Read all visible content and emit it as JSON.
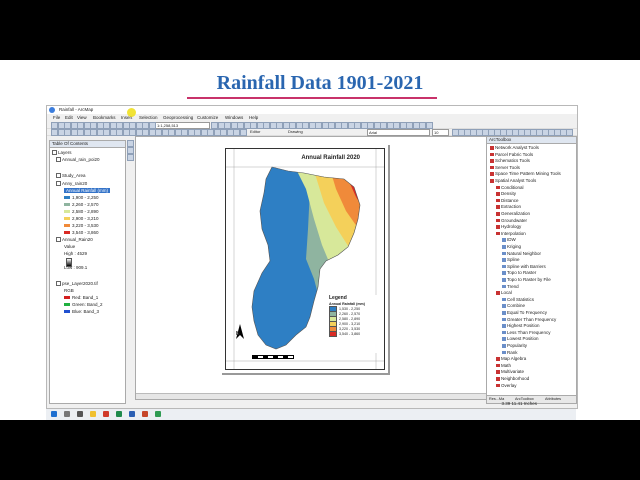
{
  "slide_title": "Rainfall Data 1901-2021",
  "window": {
    "title": "Rainfall - ArcMap"
  },
  "menu": [
    "File",
    "Edit",
    "View",
    "Bookmarks",
    "Insert",
    "Selection",
    "Geoprocessing",
    "Customize",
    "Windows",
    "Help"
  ],
  "toolbar": {
    "scale": "1:1,258,513",
    "drawing_label": "Drawing",
    "font": "Arial",
    "font_size": "10",
    "editor_label": "Editor"
  },
  "toc": {
    "title": "Table Of Contents",
    "rows": [
      {
        "label": "Layers"
      },
      {
        "label": "Annual_rain_poi20"
      },
      {
        "label": "Study_Area"
      },
      {
        "label": "Anny_rain20"
      },
      {
        "label": "Annual Rainfall (mm)",
        "highlight": true
      },
      {
        "label": "1,900 - 2,250",
        "color": "#2e7fc4"
      },
      {
        "label": "2,260 - 2,570",
        "color": "#8fb4a0"
      },
      {
        "label": "2,580 - 2,890",
        "color": "#d7e89a"
      },
      {
        "label": "2,900 - 3,210",
        "color": "#f4d05a"
      },
      {
        "label": "3,220 - 3,530",
        "color": "#f08a3a"
      },
      {
        "label": "3,540 - 3,860",
        "color": "#d92b25"
      },
      {
        "label": "Annual_Rain20"
      },
      {
        "label": "Value"
      },
      {
        "label": "High : 4529"
      },
      {
        "label": "Low : 909.1"
      },
      {
        "label": "pse_Layer2020.tif"
      },
      {
        "label": "RGB"
      },
      {
        "label": "Red:  Band_1",
        "color": "#d42020"
      },
      {
        "label": "Green: Band_2",
        "color": "#20b040"
      },
      {
        "label": "Blue:  Band_3",
        "color": "#2050d0"
      }
    ]
  },
  "map": {
    "title": "Annual Rainfall 2020",
    "legend_title": "Legend",
    "legend_subtitle": "Annual Rainfall (mm)",
    "legend": [
      {
        "label": "1,530 - 2,250",
        "color": "#2e7fc4"
      },
      {
        "label": "2,260 - 2,570",
        "color": "#8fb4a0"
      },
      {
        "label": "2,580 - 2,890",
        "color": "#d7e89a"
      },
      {
        "label": "2,900 - 3,210",
        "color": "#f4d05a"
      },
      {
        "label": "3,220 - 3,530",
        "color": "#f08a3a"
      },
      {
        "label": "3,540 - 3,860",
        "color": "#d92b25"
      }
    ],
    "north": "N"
  },
  "arctoolbox": {
    "title": "ArcToolbox",
    "items": [
      {
        "label": "Network Analyst Tools",
        "level": 0
      },
      {
        "label": "Parcel Fabric Tools",
        "level": 0
      },
      {
        "label": "Schematics Tools",
        "level": 0
      },
      {
        "label": "Server Tools",
        "level": 0
      },
      {
        "label": "Space Time Pattern Mining Tools",
        "level": 0
      },
      {
        "label": "Spatial Analyst Tools",
        "level": 0
      },
      {
        "label": "Conditional",
        "level": 1
      },
      {
        "label": "Density",
        "level": 1
      },
      {
        "label": "Distance",
        "level": 1
      },
      {
        "label": "Extraction",
        "level": 1
      },
      {
        "label": "Generalization",
        "level": 1
      },
      {
        "label": "Groundwater",
        "level": 1
      },
      {
        "label": "Hydrology",
        "level": 1
      },
      {
        "label": "Interpolation",
        "level": 1
      },
      {
        "label": "IDW",
        "level": 2
      },
      {
        "label": "Kriging",
        "level": 2
      },
      {
        "label": "Natural Neighbor",
        "level": 2
      },
      {
        "label": "Spline",
        "level": 2
      },
      {
        "label": "Spline with Barriers",
        "level": 2
      },
      {
        "label": "Topo to Raster",
        "level": 2
      },
      {
        "label": "Topo to Raster by File",
        "level": 2
      },
      {
        "label": "Trend",
        "level": 2
      },
      {
        "label": "Local",
        "level": 1
      },
      {
        "label": "Cell Statistics",
        "level": 2
      },
      {
        "label": "Combine",
        "level": 2
      },
      {
        "label": "Equal To Frequency",
        "level": 2
      },
      {
        "label": "Greater Than Frequency",
        "level": 2
      },
      {
        "label": "Highest Position",
        "level": 2
      },
      {
        "label": "Less Than Frequency",
        "level": 2
      },
      {
        "label": "Lowest Position",
        "level": 2
      },
      {
        "label": "Popularity",
        "level": 2
      },
      {
        "label": "Rank",
        "level": 2
      },
      {
        "label": "Map Algebra",
        "level": 1
      },
      {
        "label": "Math",
        "level": 1
      },
      {
        "label": "Multivariate",
        "level": 1
      },
      {
        "label": "Neighborhood",
        "level": 1
      },
      {
        "label": "Overlay",
        "level": 1
      }
    ],
    "tabs": [
      "Res...Ma",
      "ArcToolbox",
      "Attributes"
    ]
  },
  "status": "3.39  11.41 Inches",
  "colors": {
    "title_text": "#2a66b0",
    "underline": "#c8326a",
    "selection": "#3473c8"
  }
}
